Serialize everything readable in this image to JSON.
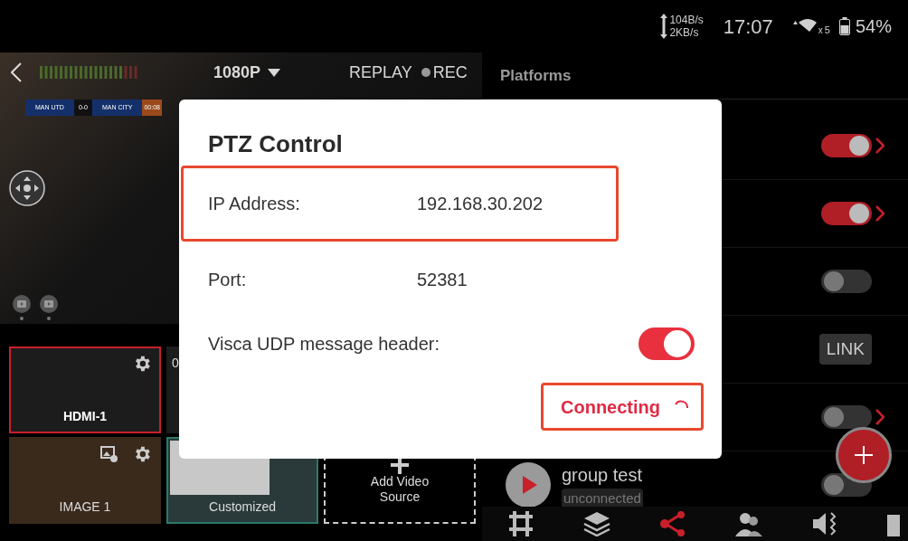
{
  "status_bar": {
    "upload": "104B/s",
    "download": "2KB/s",
    "time": "17:07",
    "wifi_sub": "x",
    "wifi_badge": "5",
    "battery": "54%"
  },
  "preview": {
    "resolution": "1080P",
    "replay": "REPLAY",
    "rec": "REC",
    "scoreboard": {
      "home": "MAN UTD",
      "score": "0-0",
      "away": "MAN CITY",
      "clock": "00:08"
    }
  },
  "sources": [
    {
      "kind": "camera",
      "label": "HDMI-1",
      "selected": true
    },
    {
      "kind": "camera",
      "corner_text": "0",
      "selected": false
    },
    {
      "kind": "image",
      "label": "IMAGE 1",
      "selected": false
    },
    {
      "kind": "custom",
      "label": "Customized",
      "selected": false
    },
    {
      "kind": "add",
      "label": "Add Video Source"
    }
  ],
  "platforms": {
    "title": "Platforms",
    "rows": [
      {
        "kind": "toggle",
        "on": true,
        "chevron": true
      },
      {
        "kind": "toggle",
        "on": true,
        "chevron": true
      },
      {
        "kind": "toggle",
        "on": false,
        "chevron": false
      },
      {
        "kind": "link",
        "label": "LINK"
      },
      {
        "kind": "toggle",
        "on": false,
        "chevron": true
      },
      {
        "kind": "group",
        "name": "group test",
        "status": "unconnected",
        "on": false
      }
    ]
  },
  "nav": [
    {
      "kind": "mixer",
      "selected": false
    },
    {
      "kind": "layers",
      "selected": false
    },
    {
      "kind": "share",
      "selected": true
    },
    {
      "kind": "users",
      "selected": false
    },
    {
      "kind": "audio",
      "selected": false
    },
    {
      "kind": "more",
      "selected": false
    }
  ],
  "dialog": {
    "title": "PTZ Control",
    "fields": [
      {
        "label": "IP Address:",
        "value": "192.168.30.202",
        "highlighted": true
      },
      {
        "label": "Port:",
        "value": "52381",
        "highlighted": false
      }
    ],
    "visca": {
      "label": "Visca UDP message header:",
      "on": true
    },
    "button": {
      "label": "Connecting",
      "highlighted": true,
      "busy": true
    }
  }
}
